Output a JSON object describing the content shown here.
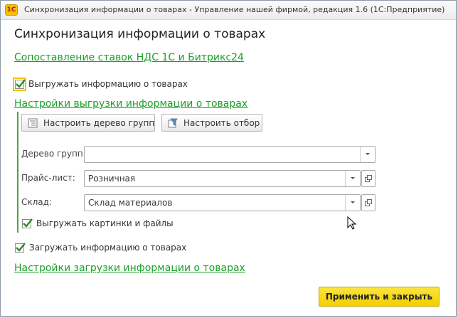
{
  "window": {
    "app_icon_text": "1С",
    "title": "Синхронизация информации о товарах - Управление нашей фирмой, редакция 1.6  (1С:Предприятие)"
  },
  "form": {
    "title": "Синхронизация информации о товарах",
    "vat_link": "Сопоставление ставок НДС 1С и Битрикс24",
    "export": {
      "checkbox_label": "Выгружать информацию о товарах",
      "checked": true,
      "settings_link": "Настройки выгрузки информации о товарах",
      "buttons": {
        "group_tree": "Настроить дерево групп",
        "filter": "Настроить отбор"
      },
      "fields": {
        "group_tree": {
          "label": "Дерево групп:",
          "value": ""
        },
        "price_list": {
          "label": "Прайс-лист:",
          "value": "Розничная"
        },
        "warehouse": {
          "label": "Склад:",
          "value": "Склад материалов"
        }
      },
      "images_checkbox_label": "Выгружать картинки и файлы",
      "images_checked": true
    },
    "import": {
      "checkbox_label": "Загружать информацию о товарах",
      "checked": true,
      "settings_link": "Настройки загрузки информации о товарах"
    },
    "apply_button": "Применить и закрыть"
  },
  "colors": {
    "link": "#1aa02a",
    "primary_button": "#f2cf00",
    "check": "#2f8a2a"
  }
}
